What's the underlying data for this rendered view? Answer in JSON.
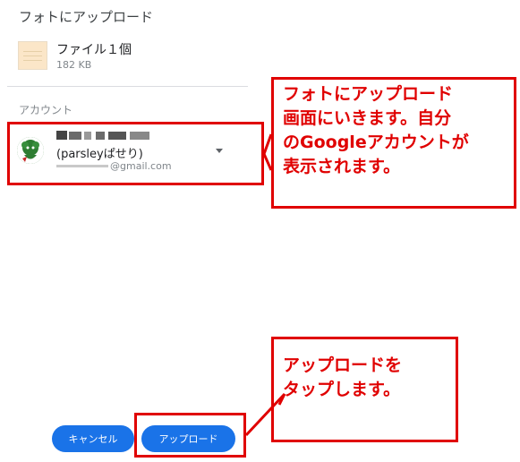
{
  "dialog": {
    "title": "フォトにアップロード",
    "file": {
      "name": "ファイル１個",
      "size": "182 KB",
      "icon": "image-file-icon"
    },
    "account": {
      "section_label": "アカウント",
      "nickname": "(parsleyぱせり)",
      "email": "@gmail.com",
      "avatar_icon": "avatar-icon",
      "dropdown_icon": "dropdown-arrow-icon"
    },
    "buttons": {
      "cancel": "キャンセル",
      "upload": "アップロード"
    }
  },
  "annotations": {
    "top_callout": [
      "フォトにアップロード",
      "画面にいきます。自分",
      "のGoogleアカウントが",
      "表示されます。"
    ],
    "bottom_callout": [
      "アップロードを",
      "タップします。"
    ],
    "highlight_color": "#e00000"
  },
  "colors": {
    "button": "#1a73e8",
    "annotation": "#e00000"
  }
}
